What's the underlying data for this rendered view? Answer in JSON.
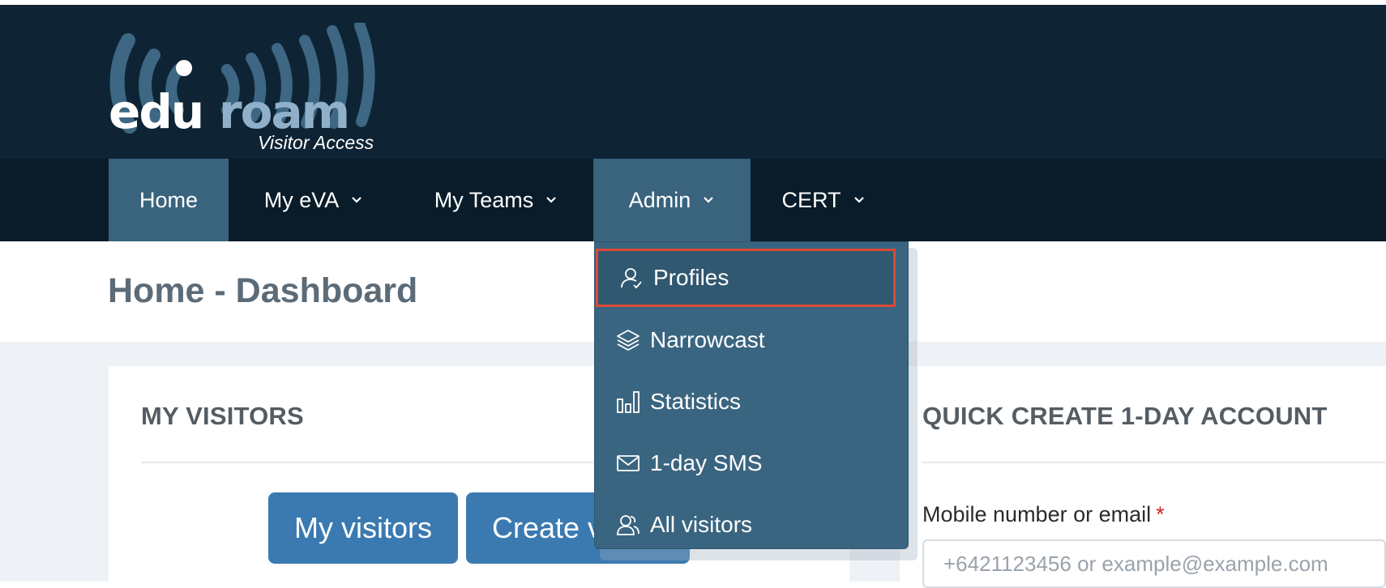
{
  "header": {
    "logo_text": "eduroam",
    "logo_tagline": "Visitor Access"
  },
  "nav": {
    "items": [
      {
        "label": "Home",
        "has_dropdown": false,
        "active": true
      },
      {
        "label": "My eVA",
        "has_dropdown": true,
        "active": false
      },
      {
        "label": "My Teams",
        "has_dropdown": true,
        "active": false
      },
      {
        "label": "Admin",
        "has_dropdown": true,
        "active": true
      },
      {
        "label": "CERT",
        "has_dropdown": true,
        "active": false
      }
    ]
  },
  "admin_menu": {
    "items": [
      {
        "label": "Profiles",
        "icon": "user-check-icon",
        "highlighted": true
      },
      {
        "label": "Narrowcast",
        "icon": "layers-icon",
        "highlighted": false
      },
      {
        "label": "Statistics",
        "icon": "bar-chart-icon",
        "highlighted": false
      },
      {
        "label": "1-day SMS",
        "icon": "envelope-icon",
        "highlighted": false
      },
      {
        "label": "All visitors",
        "icon": "users-icon",
        "highlighted": false
      }
    ]
  },
  "page": {
    "title": "Home - Dashboard"
  },
  "my_visitors": {
    "heading": "MY VISITORS",
    "my_visitors_button": "My visitors",
    "create_button": "Create v"
  },
  "quick_create": {
    "heading": "QUICK CREATE 1-DAY ACCOUNT",
    "field_label": "Mobile number or email",
    "required_mark": "*",
    "field_placeholder": "+6421123456 or example@example.com"
  },
  "colors": {
    "header_bg": "#0e2435",
    "navbar_bg": "#0a1c29",
    "nav_active": "#3a647e",
    "dropdown_bg": "#3a6580",
    "highlight_border": "#d94a36",
    "button_bg": "#3a7ab0"
  }
}
